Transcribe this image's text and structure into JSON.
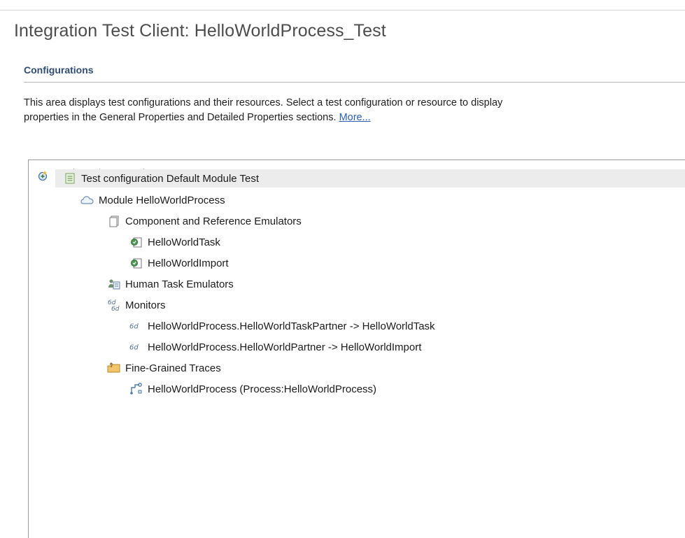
{
  "header": {
    "title": "Integration Test Client: HelloWorldProcess_Test"
  },
  "section": {
    "title": "Configurations",
    "description_line1": "This area displays test configurations and their resources. Select a test configuration or resource to display",
    "description_line2": "properties in the General Properties and Detailed Properties sections.",
    "more_link": "More..."
  },
  "toolbar": {
    "buttons": [
      {
        "icon": "add-configuration-icon"
      },
      {
        "icon": "remove-icon"
      },
      {
        "icon": "collapse-all-icon"
      },
      {
        "icon": "search-icon"
      },
      {
        "icon": "search-settings-icon"
      },
      {
        "icon": "save-icon"
      }
    ]
  },
  "tree": {
    "items": [
      {
        "label": "Test configuration Default Module Test",
        "icon": "test-configuration-icon",
        "level": 0,
        "selected": true
      },
      {
        "label": "Module HelloWorldProcess",
        "icon": "module-icon",
        "level": 1
      },
      {
        "label": "Component and Reference Emulators",
        "icon": "emulators-folder-icon",
        "level": 2
      },
      {
        "label": "HelloWorldTask",
        "icon": "emulator-icon",
        "level": 3
      },
      {
        "label": "HelloWorldImport",
        "icon": "emulator-icon",
        "level": 3
      },
      {
        "label": "Human Task Emulators",
        "icon": "human-task-icon",
        "level": 2
      },
      {
        "label": "Monitors",
        "icon": "monitors-icon",
        "level": 2
      },
      {
        "label": "HelloWorldProcess.HelloWorldTaskPartner -> HelloWorldTask",
        "icon": "monitor-icon",
        "level": 3
      },
      {
        "label": "HelloWorldProcess.HelloWorldPartner -> HelloWorldImport",
        "icon": "monitor-icon",
        "level": 3
      },
      {
        "label": "Fine-Grained Traces",
        "icon": "traces-folder-icon",
        "level": 2
      },
      {
        "label": "HelloWorldProcess (Process:HelloWorldProcess)",
        "icon": "process-icon",
        "level": 3
      }
    ]
  },
  "colors": {
    "section_title": "#2f4d74",
    "link": "#2b5fb0",
    "selection": "#ececec"
  }
}
